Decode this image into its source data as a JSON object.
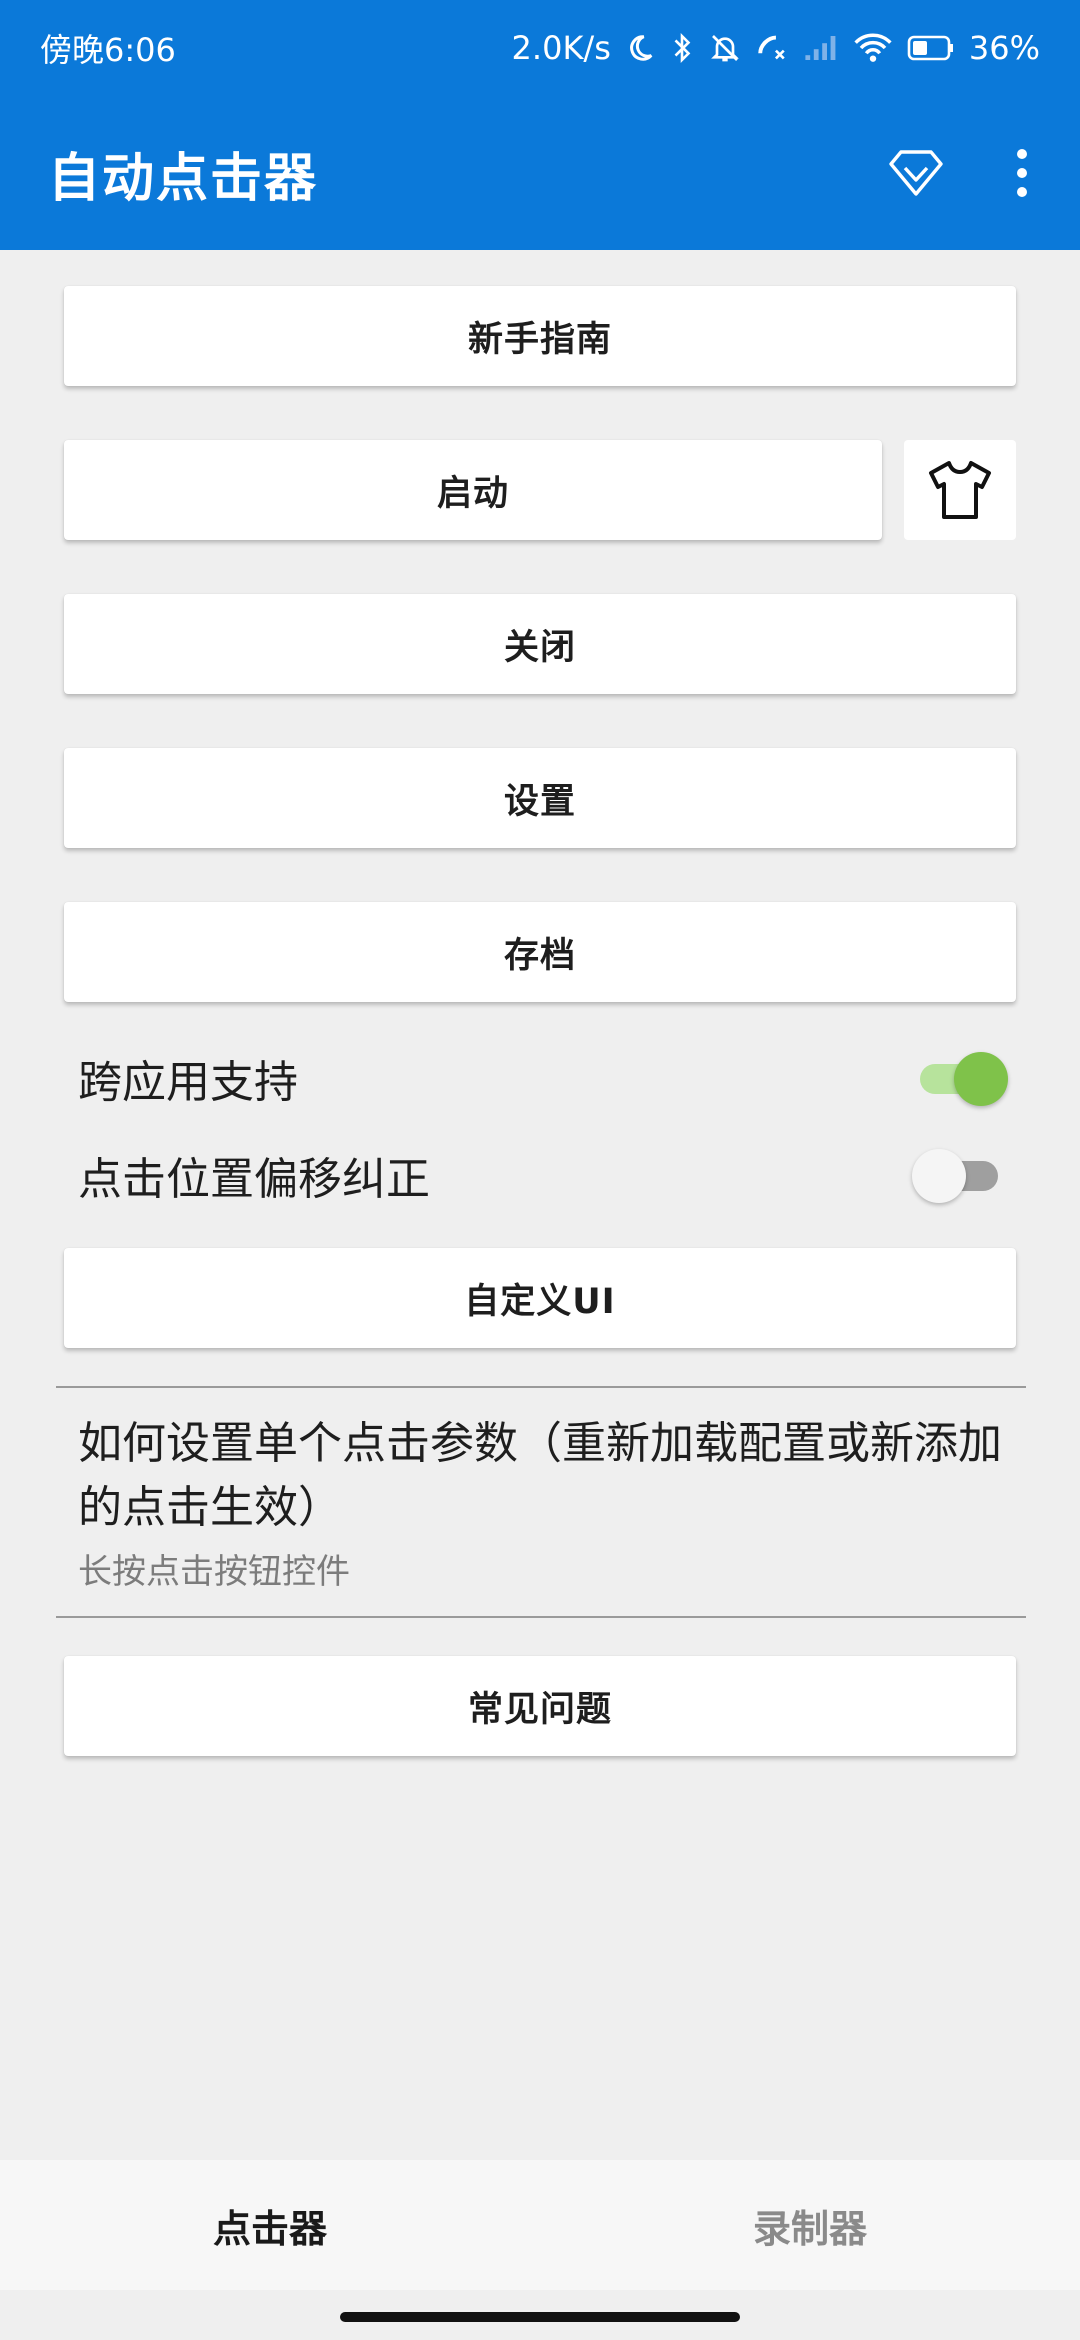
{
  "status_bar": {
    "time": "傍晚6:06",
    "network_speed": "2.0K/s",
    "battery_percent": "36%",
    "icons": [
      "moon-icon",
      "bluetooth-icon",
      "mute-bell-icon",
      "call-missed-icon",
      "signal-icon",
      "wifi-icon",
      "battery-icon"
    ]
  },
  "app_bar": {
    "title": "自动点击器",
    "icons": [
      "premium-diamond-icon",
      "more-vert-icon"
    ]
  },
  "buttons": {
    "guide": "新手指南",
    "start": "启动",
    "close": "关闭",
    "settings": "设置",
    "archive": "存档",
    "custom_ui": "自定义UI",
    "faq": "常见问题"
  },
  "toggles": [
    {
      "label": "跨应用支持",
      "state": "on"
    },
    {
      "label": "点击位置偏移纠正",
      "state": "off"
    }
  ],
  "info": {
    "title": "如何设置单个点击参数（重新加载配置或新添加的点击生效）",
    "subtitle": "长按点击按钮控件"
  },
  "bottom_nav": {
    "tabs": [
      {
        "label": "点击器",
        "active": true
      },
      {
        "label": "录制器",
        "active": false
      }
    ]
  },
  "colors": {
    "primary": "#0b79d9",
    "toggle_on": "#7fc24a",
    "background": "#efefef"
  }
}
